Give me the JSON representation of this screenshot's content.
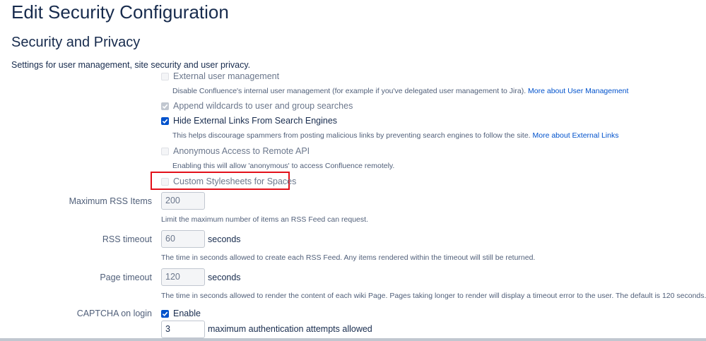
{
  "page": {
    "title": "Edit Security Configuration"
  },
  "section": {
    "title": "Security and Privacy",
    "description": "Settings for user management, site security and user privacy."
  },
  "options": {
    "external_user_mgmt": {
      "label": "External user management",
      "checked": false,
      "disabled": true,
      "description": "Disable Confluence's internal user management (for example if you've delegated user management to Jira).",
      "link": "More about User Management"
    },
    "append_wildcards": {
      "label": "Append wildcards to user and group searches",
      "checked": true,
      "disabled": true
    },
    "hide_external_links": {
      "label": "Hide External Links From Search Engines",
      "checked": true,
      "disabled": false,
      "description": "This helps discourage spammers from posting malicious links by preventing search engines to follow the site.",
      "link": "More about External Links"
    },
    "anonymous_remote_api": {
      "label": "Anonymous Access to Remote API",
      "checked": false,
      "disabled": true,
      "description": "Enabling this will allow 'anonymous' to access Confluence remotely."
    },
    "custom_stylesheets": {
      "label": "Custom Stylesheets for Spaces",
      "checked": false,
      "disabled": true
    }
  },
  "fields": {
    "max_rss_items": {
      "label": "Maximum RSS Items",
      "value": "200",
      "description": "Limit the maximum number of items an RSS Feed can request."
    },
    "rss_timeout": {
      "label": "RSS timeout",
      "value": "60",
      "unit": "seconds",
      "description": "The time in seconds allowed to create each RSS Feed. Any items rendered within the timeout will still be returned."
    },
    "page_timeout": {
      "label": "Page timeout",
      "value": "120",
      "unit": "seconds",
      "description": "The time in seconds allowed to render the content of each wiki Page. Pages taking longer to render will display a timeout error to the user. The default is 120 seconds."
    },
    "captcha": {
      "label": "CAPTCHA on login",
      "enable_label": "Enable",
      "checked": true,
      "attempts_value": "3",
      "attempts_unit": "maximum authentication attempts allowed"
    }
  },
  "colors": {
    "accent": "#0052cc",
    "highlight": "#e3101a",
    "text": "#172b4d",
    "muted": "#505f79"
  }
}
